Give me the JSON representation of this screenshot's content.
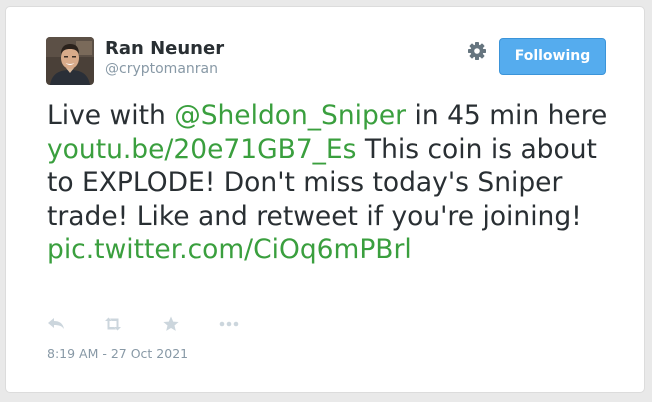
{
  "author": {
    "display_name": "Ran Neuner",
    "handle": "@cryptomanran"
  },
  "header": {
    "settings_icon": "gear-icon",
    "follow_label": "Following",
    "follow_color": "#55acee"
  },
  "tweet": {
    "part1": "Live with ",
    "mention": "@Sheldon_Sniper",
    "part2": " in 45 min here ",
    "link": "youtu.be/20e71GB7_Es",
    "part3": " This coin is about to EXPLODE! Don't miss today's Sniper trade! Like and retweet if you're joining! ",
    "pic_link": "pic.twitter.com/CiOq6mPBrl",
    "link_color": "#3a9f3e"
  },
  "actions": {
    "icons": [
      "reply-icon",
      "retweet-icon",
      "favorite-icon",
      "more-icon"
    ]
  },
  "timestamp": "8:19 AM - 27 Oct 2021"
}
